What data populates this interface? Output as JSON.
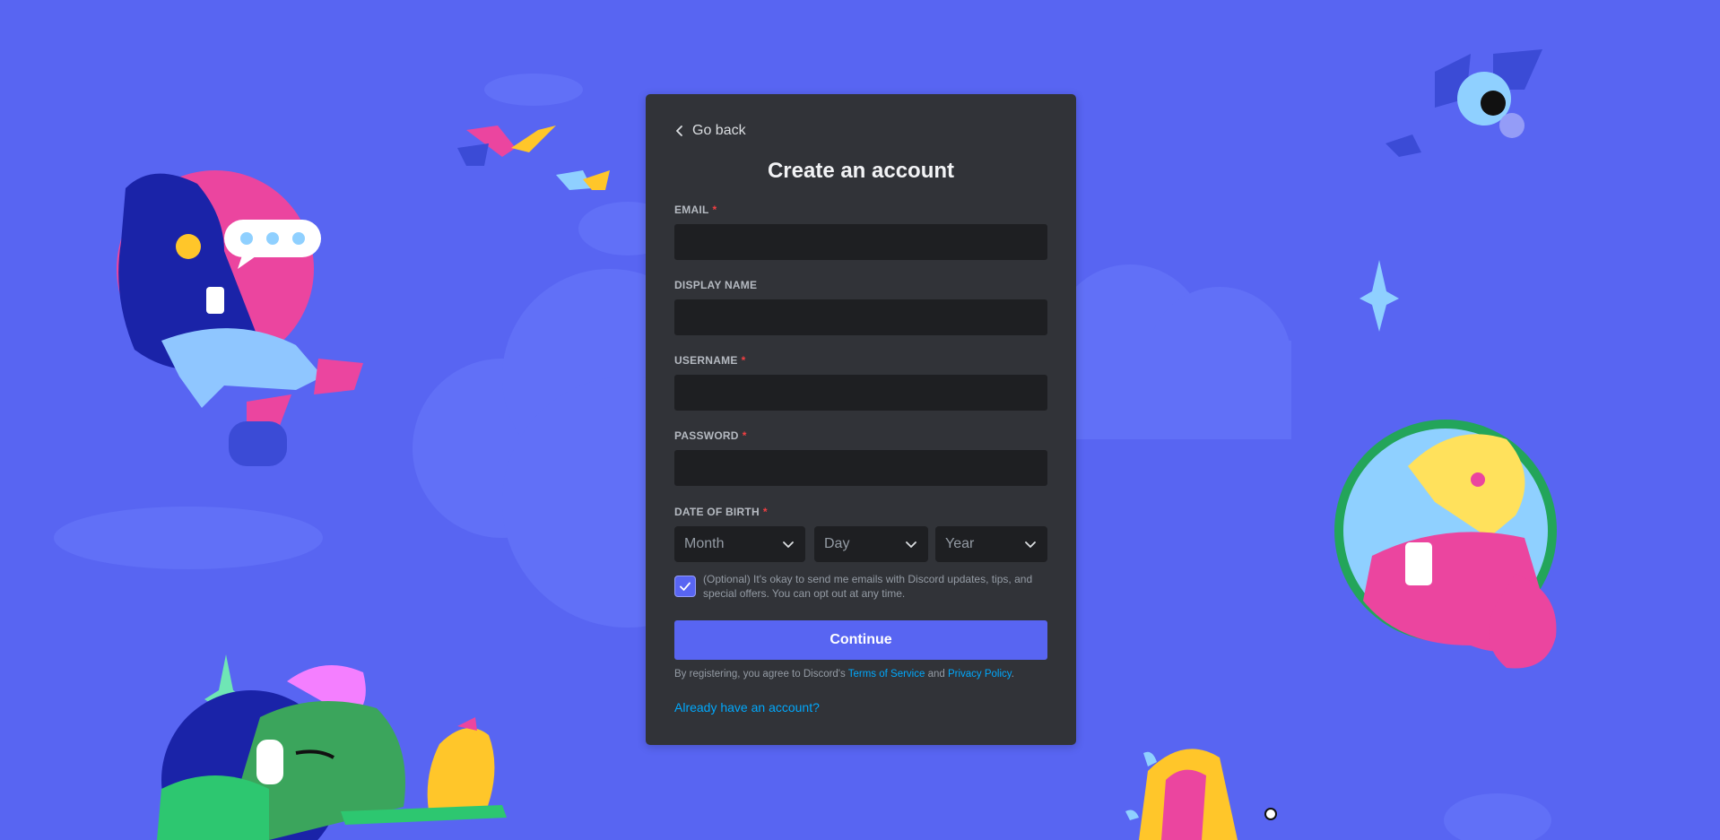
{
  "app": "Discord",
  "colors": {
    "background": "#5865f2",
    "card": "#313338",
    "input": "#1e1f22",
    "accent": "#5865f2",
    "link": "#00a8fc",
    "required": "#f23f42"
  },
  "nav": {
    "go_back_label": "Go back",
    "go_back_icon": "chevron-left-icon"
  },
  "form": {
    "title": "Create an account",
    "fields": {
      "email": {
        "label": "EMAIL",
        "required_mark": "*",
        "value": ""
      },
      "display_name": {
        "label": "DISPLAY NAME",
        "value": ""
      },
      "username": {
        "label": "USERNAME",
        "required_mark": "*",
        "value": ""
      },
      "password": {
        "label": "PASSWORD",
        "required_mark": "*",
        "value": ""
      }
    },
    "dob": {
      "label": "DATE OF BIRTH",
      "required_mark": "*",
      "month_placeholder": "Month",
      "day_placeholder": "Day",
      "year_placeholder": "Year",
      "dropdown_icon": "chevron-down-icon"
    },
    "optin": {
      "checked": true,
      "text": "(Optional) It's okay to send me emails with Discord updates, tips, and special offers. You can opt out at any time."
    },
    "submit_label": "Continue",
    "legal": {
      "prefix": "By registering, you agree to Discord's ",
      "tos_link": "Terms of Service",
      "middle": " and ",
      "privacy_link": "Privacy Policy",
      "suffix": "."
    },
    "login_link": "Already have an account?"
  }
}
